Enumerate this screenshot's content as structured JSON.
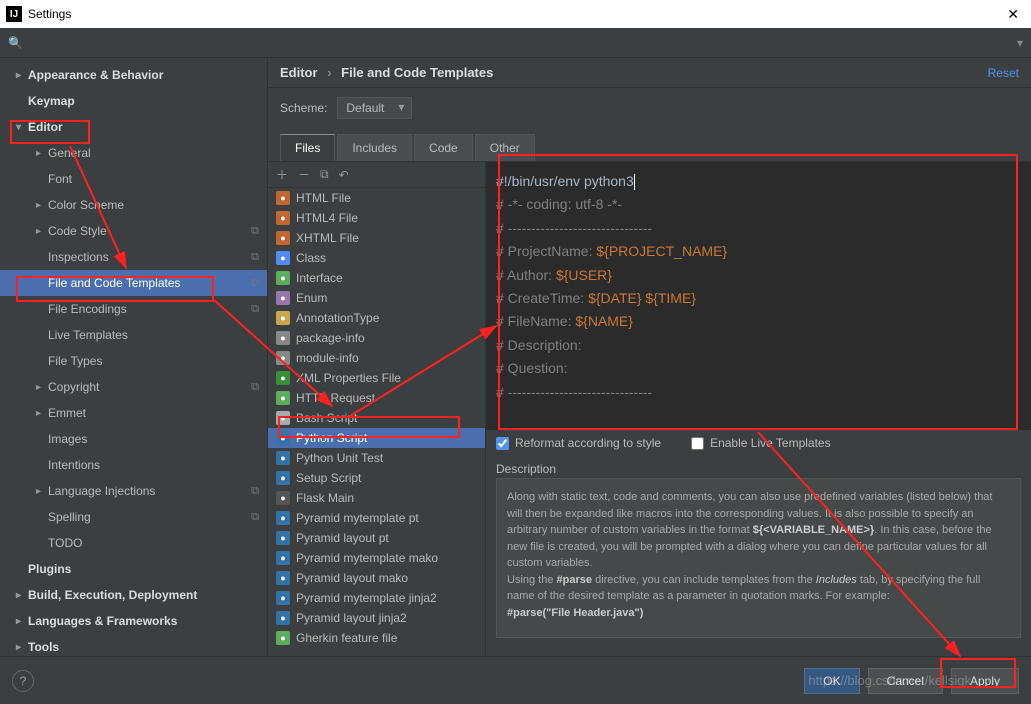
{
  "window": {
    "title": "Settings"
  },
  "search": {
    "placeholder": ""
  },
  "breadcrumb": {
    "root": "Editor",
    "leaf": "File and Code Templates",
    "reset": "Reset"
  },
  "scheme": {
    "label": "Scheme:",
    "value": "Default"
  },
  "tabs": [
    "Files",
    "Includes",
    "Code",
    "Other"
  ],
  "sidebar": [
    {
      "label": "Appearance & Behavior",
      "level": 1,
      "arrow": "▸"
    },
    {
      "label": "Keymap",
      "level": 1,
      "arrow": ""
    },
    {
      "label": "Editor",
      "level": 1,
      "arrow": "▾",
      "box": true
    },
    {
      "label": "General",
      "level": 2,
      "arrow": "▸"
    },
    {
      "label": "Font",
      "level": 2,
      "arrow": ""
    },
    {
      "label": "Color Scheme",
      "level": 2,
      "arrow": "▸"
    },
    {
      "label": "Code Style",
      "level": 2,
      "arrow": "▸",
      "copy": true
    },
    {
      "label": "Inspections",
      "level": 2,
      "arrow": "",
      "copy": true
    },
    {
      "label": "File and Code Templates",
      "level": 2,
      "arrow": "",
      "selected": true,
      "copy": true,
      "box": true
    },
    {
      "label": "File Encodings",
      "level": 2,
      "arrow": "",
      "copy": true
    },
    {
      "label": "Live Templates",
      "level": 2,
      "arrow": ""
    },
    {
      "label": "File Types",
      "level": 2,
      "arrow": ""
    },
    {
      "label": "Copyright",
      "level": 2,
      "arrow": "▸",
      "copy": true
    },
    {
      "label": "Emmet",
      "level": 2,
      "arrow": "▸"
    },
    {
      "label": "Images",
      "level": 2,
      "arrow": ""
    },
    {
      "label": "Intentions",
      "level": 2,
      "arrow": ""
    },
    {
      "label": "Language Injections",
      "level": 2,
      "arrow": "▸",
      "copy": true
    },
    {
      "label": "Spelling",
      "level": 2,
      "arrow": "",
      "copy": true
    },
    {
      "label": "TODO",
      "level": 2,
      "arrow": ""
    },
    {
      "label": "Plugins",
      "level": 1,
      "arrow": ""
    },
    {
      "label": "Build, Execution, Deployment",
      "level": 1,
      "arrow": "▸"
    },
    {
      "label": "Languages & Frameworks",
      "level": 1,
      "arrow": "▸"
    },
    {
      "label": "Tools",
      "level": 1,
      "arrow": "▸"
    }
  ],
  "files": [
    {
      "label": "HTML File",
      "icon": "ic-html"
    },
    {
      "label": "HTML4 File",
      "icon": "ic-html"
    },
    {
      "label": "XHTML File",
      "icon": "ic-html"
    },
    {
      "label": "Class",
      "icon": "ic-class"
    },
    {
      "label": "Interface",
      "icon": "ic-if"
    },
    {
      "label": "Enum",
      "icon": "ic-enum"
    },
    {
      "label": "AnnotationType",
      "icon": "ic-at"
    },
    {
      "label": "package-info",
      "icon": "ic-pkg"
    },
    {
      "label": "module-info",
      "icon": "ic-pkg"
    },
    {
      "label": "XML Properties File",
      "icon": "ic-xml"
    },
    {
      "label": "HTTP Request",
      "icon": "ic-http"
    },
    {
      "label": "Bash Script",
      "icon": "ic-bash"
    },
    {
      "label": "Python Script",
      "icon": "ic-py",
      "selected": true,
      "box": true
    },
    {
      "label": "Python Unit Test",
      "icon": "ic-py"
    },
    {
      "label": "Setup Script",
      "icon": "ic-py"
    },
    {
      "label": "Flask Main",
      "icon": "ic-flask"
    },
    {
      "label": "Pyramid mytemplate pt",
      "icon": "ic-py"
    },
    {
      "label": "Pyramid layout pt",
      "icon": "ic-py"
    },
    {
      "label": "Pyramid mytemplate mako",
      "icon": "ic-py"
    },
    {
      "label": "Pyramid layout mako",
      "icon": "ic-py"
    },
    {
      "label": "Pyramid mytemplate jinja2",
      "icon": "ic-py"
    },
    {
      "label": "Pyramid layout jinja2",
      "icon": "ic-py"
    },
    {
      "label": "Gherkin feature file",
      "icon": "ic-gherkin"
    }
  ],
  "code_lines": [
    {
      "t": "shebang",
      "text": "#!/bin/usr/env python3",
      "cursor": true
    },
    {
      "t": "comment",
      "text": "# -*- coding: utf-8 -*-"
    },
    {
      "t": "comment",
      "text": "# -------------------------------"
    },
    {
      "t": "comment-var",
      "prefix": "# ProjectName: ",
      "var": "${PROJECT_NAME}"
    },
    {
      "t": "comment-var",
      "prefix": "# Author: ",
      "var": "${USER}"
    },
    {
      "t": "comment-var",
      "prefix": "# CreateTime: ",
      "var": "${DATE} ${TIME}"
    },
    {
      "t": "comment-var",
      "prefix": "# FileName: ",
      "var": "${NAME}"
    },
    {
      "t": "comment",
      "text": "# Description: "
    },
    {
      "t": "comment",
      "text": "# Question: "
    },
    {
      "t": "comment",
      "text": "# -------------------------------"
    }
  ],
  "options": {
    "reformat": "Reformat according to style",
    "live": "Enable Live Templates"
  },
  "desc": {
    "label": "Description",
    "p1": "Along with static text, code and comments, you can also use predefined variables (listed below) that will then be expanded like macros into the corresponding values. It is also possible to specify an arbitrary number of custom variables in the format ",
    "p1b": "${<VARIABLE_NAME>}",
    "p1c": ". In this case, before the new file is created, you will be prompted with a dialog where you can define particular values for all custom variables.",
    "p2a": "Using the ",
    "p2b": "#parse",
    "p2c": " directive, you can include templates from the ",
    "p2d": "Includes",
    "p2e": " tab, by specifying the full name of the desired template as a parameter in quotation marks. For example:",
    "p3": "#parse(\"File Header.java\")"
  },
  "footer": {
    "ok": "OK",
    "cancel": "Cancel",
    "apply": "Apply"
  },
  "watermark": "https://blog.csdn.net/kellsigk"
}
